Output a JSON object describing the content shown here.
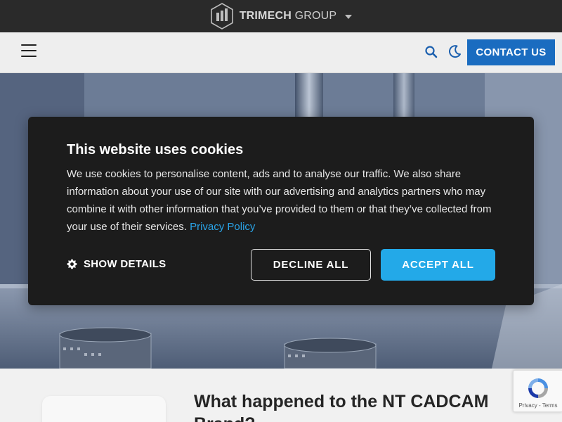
{
  "brand": {
    "name_bold": "TRIMECH",
    "name_rest": " GROUP"
  },
  "nav": {
    "contact_label": "CONTACT US"
  },
  "cookie": {
    "title": "This website uses cookies",
    "body": "We use cookies to personalise content, ads and to analyse our traffic. We also share information about your use of our site with our advertising and analytics partners who may combine it with other information that you’ve provided to them or that they’ve collected from your use of their services.",
    "privacy_link": "Privacy Policy",
    "show_details": "SHOW DETAILS",
    "decline": "DECLINE ALL",
    "accept": "ACCEPT ALL"
  },
  "article": {
    "title": "What happened to the NT CADCAM Brand?"
  },
  "recaptcha": {
    "links": "Privacy - Terms"
  },
  "colors": {
    "brand_bar": "#2a2a2a",
    "contact_button": "#1a6cc0",
    "accept_button": "#23a9e8",
    "link": "#2aa4e8",
    "dialog": "#1c1c1c"
  },
  "icons": [
    "trimech-logo-icon",
    "chevron-down-icon",
    "hamburger-menu-icon",
    "search-icon",
    "moon-icon",
    "gear-icon",
    "recaptcha-icon"
  ]
}
